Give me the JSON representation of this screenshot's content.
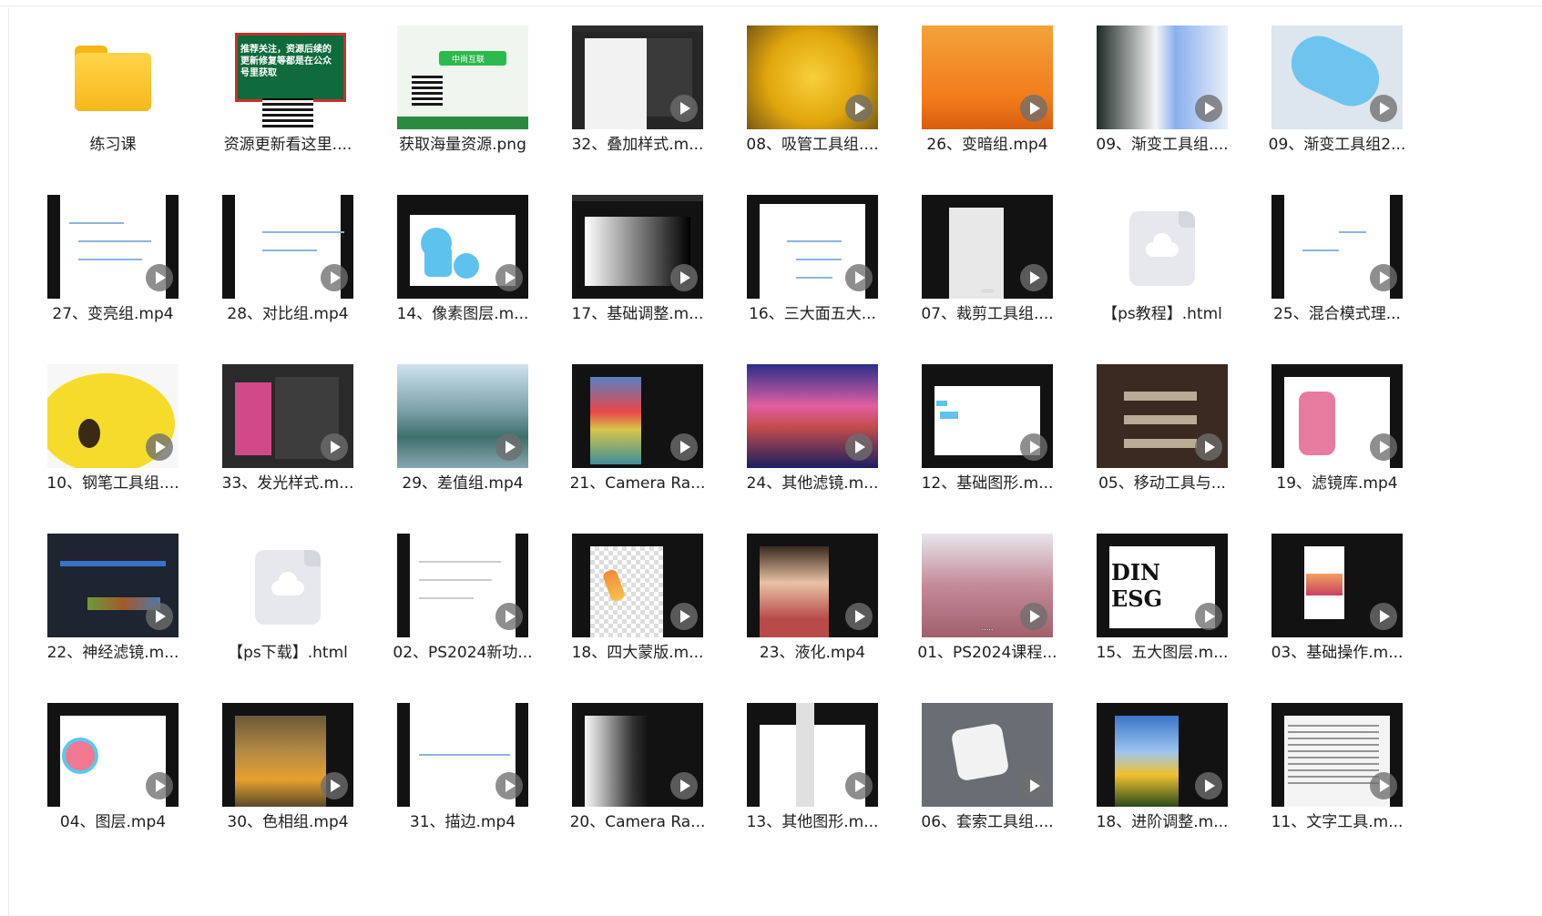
{
  "files": [
    {
      "name": "练习课",
      "kind": "folder"
    },
    {
      "name": "资源更新看这里....",
      "kind": "image",
      "thumb_text": "推荐关注，资源后续的更新修复等都是在公众号里获取"
    },
    {
      "name": "获取海量资源.png",
      "kind": "image",
      "thumb_text": "中尚互联"
    },
    {
      "name": "32、叠加样式.m...",
      "kind": "video"
    },
    {
      "name": "08、吸管工具组....",
      "kind": "video"
    },
    {
      "name": "26、变暗组.mp4",
      "kind": "video"
    },
    {
      "name": "09、渐变工具组....",
      "kind": "video"
    },
    {
      "name": "09、渐变工具组2...",
      "kind": "video"
    },
    {
      "name": "27、变亮组.mp4",
      "kind": "video"
    },
    {
      "name": "28、对比组.mp4",
      "kind": "video"
    },
    {
      "name": "14、像素图层.m...",
      "kind": "video"
    },
    {
      "name": "17、基础调整.m...",
      "kind": "video"
    },
    {
      "name": "16、三大面五大...",
      "kind": "video"
    },
    {
      "name": "07、裁剪工具组....",
      "kind": "video"
    },
    {
      "name": "【ps教程】.html",
      "kind": "html"
    },
    {
      "name": "25、混合模式理...",
      "kind": "video"
    },
    {
      "name": "10、钢笔工具组....",
      "kind": "video"
    },
    {
      "name": "33、发光样式.m...",
      "kind": "video"
    },
    {
      "name": "29、差值组.mp4",
      "kind": "video"
    },
    {
      "name": "21、Camera Ra...",
      "kind": "video"
    },
    {
      "name": "24、其他滤镜.m...",
      "kind": "video"
    },
    {
      "name": "12、基础图形.m...",
      "kind": "video"
    },
    {
      "name": "05、移动工具与...",
      "kind": "video"
    },
    {
      "name": "19、滤镜库.mp4",
      "kind": "video"
    },
    {
      "name": "22、神经滤镜.m...",
      "kind": "video"
    },
    {
      "name": "【ps下载】.html",
      "kind": "html"
    },
    {
      "name": "02、PS2024新功...",
      "kind": "video"
    },
    {
      "name": "18、四大蒙版.m...",
      "kind": "video"
    },
    {
      "name": "23、液化.mp4",
      "kind": "video"
    },
    {
      "name": "01、PS2024课程...",
      "kind": "video"
    },
    {
      "name": "15、五大图层.m...",
      "kind": "video"
    },
    {
      "name": "03、基础操作.m...",
      "kind": "video"
    },
    {
      "name": "04、图层.mp4",
      "kind": "video"
    },
    {
      "name": "30、色相组.mp4",
      "kind": "video"
    },
    {
      "name": "31、描边.mp4",
      "kind": "video"
    },
    {
      "name": "20、Camera Ra...",
      "kind": "video"
    },
    {
      "name": "13、其他图形.m...",
      "kind": "video"
    },
    {
      "name": "06、套索工具组....",
      "kind": "video"
    },
    {
      "name": "18、进阶调整.m...",
      "kind": "video"
    },
    {
      "name": "11、文字工具.m...",
      "kind": "video"
    }
  ]
}
